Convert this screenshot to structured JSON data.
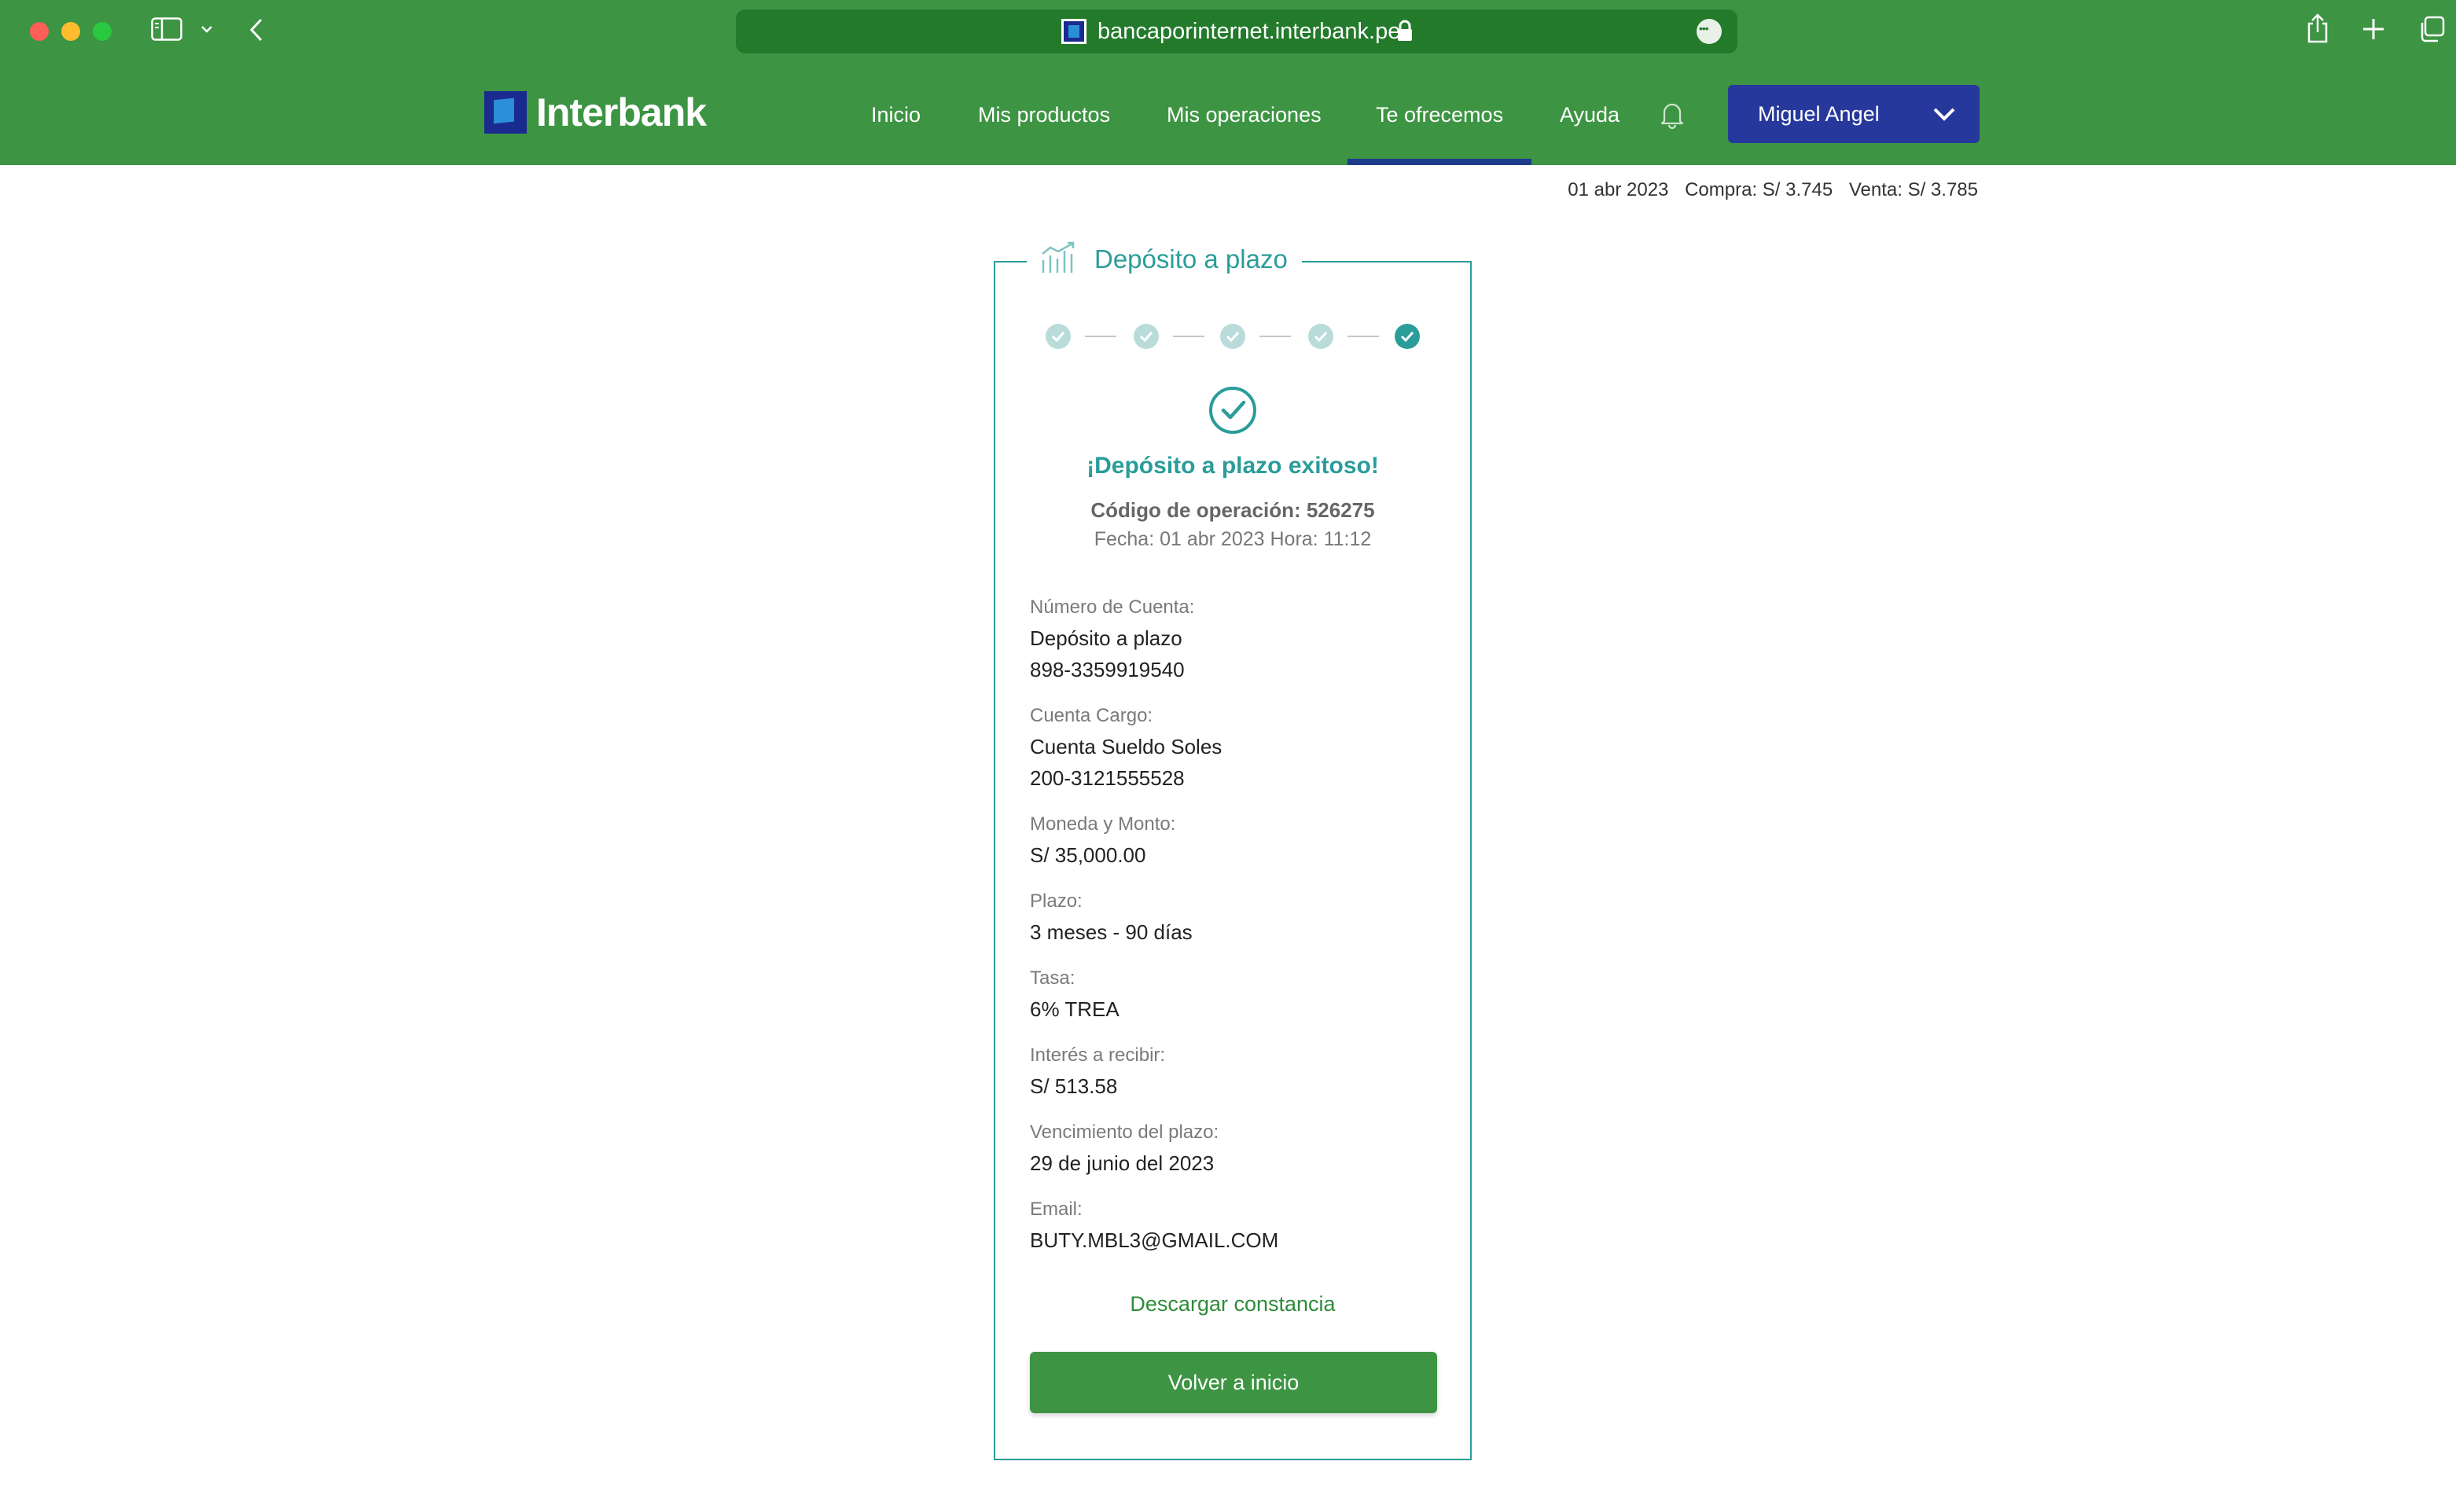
{
  "browser": {
    "url": "bancaporinternet.interbank.pe"
  },
  "header": {
    "logo_text": "Interbank",
    "nav": [
      {
        "label": "Inicio"
      },
      {
        "label": "Mis productos"
      },
      {
        "label": "Mis operaciones"
      },
      {
        "label": "Te ofrecemos",
        "active": true
      },
      {
        "label": "Ayuda"
      }
    ],
    "user_name": "Miguel Angel"
  },
  "rates": {
    "date": "01 abr 2023",
    "buy": "Compra: S/ 3.745",
    "sell": "Venta: S/ 3.785"
  },
  "card": {
    "title": "Depósito a plazo",
    "steps_total": 5,
    "steps_completed": 5,
    "success_title": "¡Depósito a plazo exitoso!",
    "operation_code": "Código de operación: 526275",
    "date_line": "Fecha: 01 abr 2023  Hora: 11:12",
    "fields": [
      {
        "label": "Número de Cuenta:",
        "values": [
          "Depósito a plazo",
          "898-3359919540"
        ]
      },
      {
        "label": "Cuenta Cargo:",
        "values": [
          "Cuenta Sueldo Soles",
          "200-3121555528"
        ]
      },
      {
        "label": "Moneda y Monto:",
        "values": [
          "S/ 35,000.00"
        ]
      },
      {
        "label": "Plazo:",
        "values": [
          "3 meses - 90 días"
        ]
      },
      {
        "label": "Tasa:",
        "values": [
          "6% TREA"
        ]
      },
      {
        "label": "Interés a recibir:",
        "values": [
          "S/ 513.58"
        ]
      },
      {
        "label": "Vencimiento del plazo:",
        "values": [
          "29 de junio del 2023"
        ]
      },
      {
        "label": "Email:",
        "values": [
          "BUTY.MBL3@GMAIL.COM"
        ]
      }
    ],
    "download_label": "Descargar constancia",
    "button_label": "Volver a inicio"
  },
  "colors": {
    "brand_green": "#3d9443",
    "brand_blue": "#27389c",
    "teal": "#2a9d9a"
  }
}
